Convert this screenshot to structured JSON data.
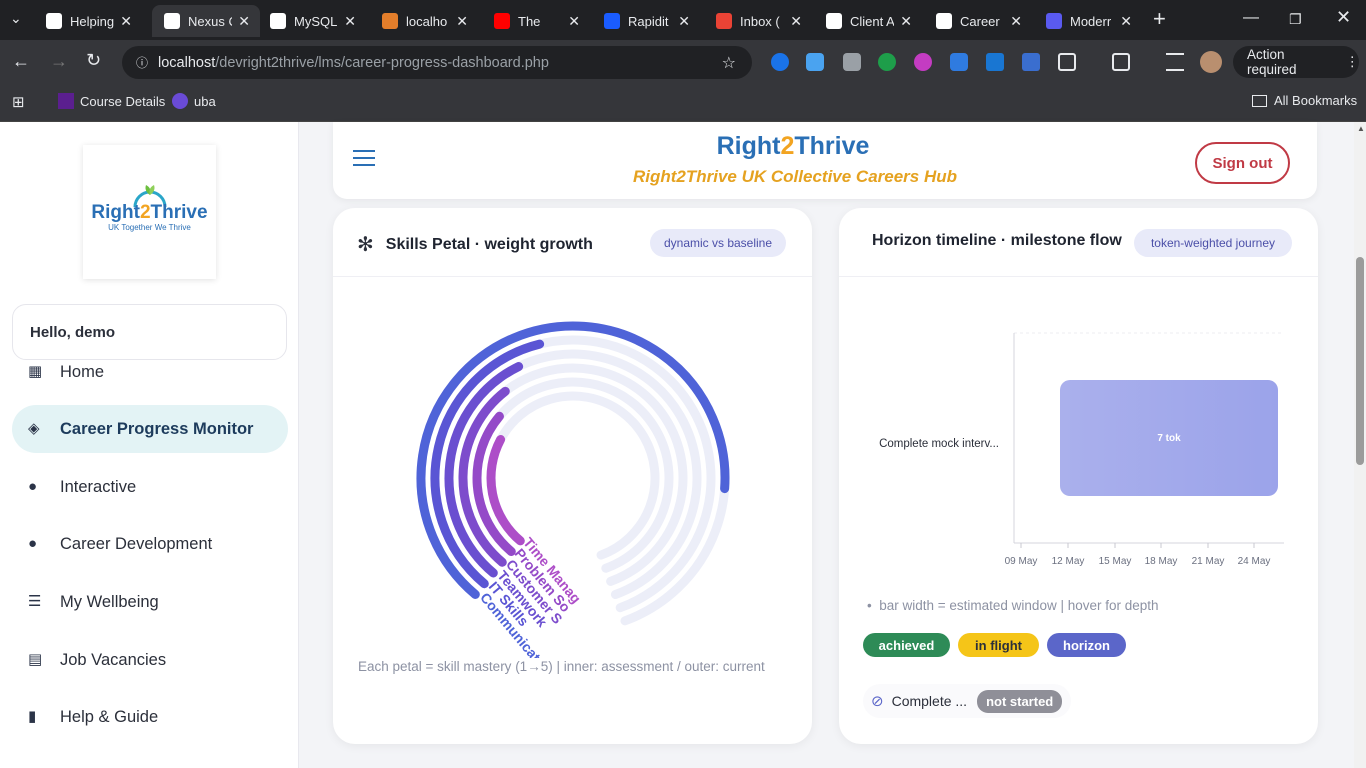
{
  "browser": {
    "tabs": [
      {
        "title": "Helping",
        "color": "#ffffff"
      },
      {
        "title": "Nexus C",
        "color": "#ffffff",
        "active": true
      },
      {
        "title": "MySQL",
        "color": "#ffffff"
      },
      {
        "title": "localho",
        "color": "#e37e2b"
      },
      {
        "title": "The",
        "color": "#ff0000"
      },
      {
        "title": "Rapidit",
        "color": "#1a5cff"
      },
      {
        "title": "Inbox (",
        "color": "#ea4335"
      },
      {
        "title": "Client A",
        "color": "#ffffff"
      },
      {
        "title": "Career",
        "color": "#ffffff"
      },
      {
        "title": "Moderr",
        "color": "#5a5af0"
      }
    ],
    "url_host": "localhost",
    "url_path": "/devright2thrive/lms/career-progress-dashboard.php",
    "action_required": "Action required",
    "bookmarks": [
      {
        "label": "Course Details"
      },
      {
        "label": "uba"
      }
    ],
    "all_bookmarks": "All Bookmarks"
  },
  "sidebar": {
    "logo_main_a": "Right",
    "logo_main_b": "2",
    "logo_main_c": "Thrive",
    "logo_sub": "UK Together We Thrive",
    "greeting": "Hello, demo",
    "items": [
      {
        "label": "Home",
        "icon": "grid-icon",
        "glyph": "▦"
      },
      {
        "label": "Career Progress Monitor",
        "icon": "layers-icon",
        "glyph": "◈",
        "active": true
      },
      {
        "label": "Interactive",
        "icon": "drop-icon",
        "glyph": "●"
      },
      {
        "label": "Career Development",
        "icon": "badge-icon",
        "glyph": "●"
      },
      {
        "label": "My Wellbeing",
        "icon": "users-icon",
        "glyph": "☰"
      },
      {
        "label": "Job Vacancies",
        "icon": "document-icon",
        "glyph": "▤"
      },
      {
        "label": "Help & Guide",
        "icon": "info-icon",
        "glyph": "▮"
      }
    ]
  },
  "header": {
    "brand_a": "Right",
    "brand_b": "2",
    "brand_c": "Thrive",
    "tagline": "Right2Thrive UK Collective Careers Hub",
    "signout": "Sign out"
  },
  "skills_card": {
    "title": "Skills Petal · weight growth",
    "pill": "dynamic vs baseline",
    "footer": "Each petal = skill mastery (1→5)  |  inner: assessment / outer: current",
    "skills": [
      "Communicat",
      "IT Skills",
      "Teamwork",
      "Customer S",
      "Problem So",
      "Time Manag"
    ],
    "current_fraction": [
      0.78,
      0.42,
      0.38,
      0.34,
      0.3,
      0.26
    ]
  },
  "timeline_card": {
    "title": "Horizon timeline · milestone flow",
    "pill": "token-weighted journey",
    "row_label": "Complete mock interv...",
    "bar_label": "7 tok",
    "x_ticks": [
      "09 May",
      "12 May",
      "15 May",
      "18 May",
      "21 May",
      "24 May"
    ],
    "note": "bar width = estimated window  |  hover for depth",
    "legend": [
      {
        "label": "achieved",
        "bg": "#2e8b57",
        "fg": "#ffffff"
      },
      {
        "label": "in flight",
        "bg": "#f5c518",
        "fg": "#2b2f3a"
      },
      {
        "label": "horizon",
        "bg": "#5b66c9",
        "fg": "#ffffff"
      }
    ],
    "milestone_text": "Complete ...",
    "milestone_status": "not started"
  }
}
